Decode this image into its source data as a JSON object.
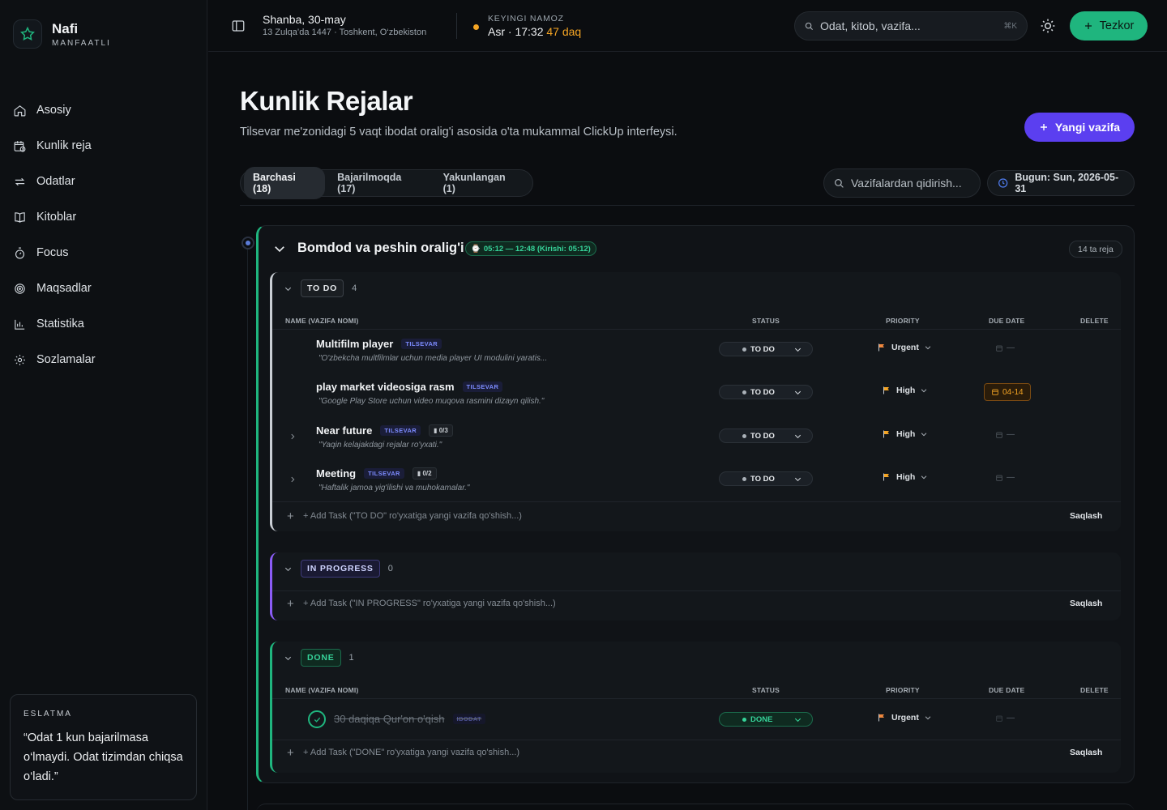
{
  "brand": {
    "name": "Nafi",
    "subtitle": "MANFAATLI"
  },
  "nav": [
    {
      "label": "Asosiy",
      "icon": "home-icon"
    },
    {
      "label": "Kunlik reja",
      "icon": "calendar-clock-icon"
    },
    {
      "label": "Odatlar",
      "icon": "repeat-icon"
    },
    {
      "label": "Kitoblar",
      "icon": "book-icon"
    },
    {
      "label": "Focus",
      "icon": "timer-icon"
    },
    {
      "label": "Maqsadlar",
      "icon": "target-icon"
    },
    {
      "label": "Statistika",
      "icon": "bar-chart-icon"
    },
    {
      "label": "Sozlamalar",
      "icon": "gear-icon"
    }
  ],
  "reminder": {
    "title": "ESLATMA",
    "text": "“Odat 1 kun bajarilmasa o‘lmaydi. Odat tizimdan chiqsa o‘ladi.”"
  },
  "topbar": {
    "date": "Shanba, 30-may",
    "hijri": "13 Zulqa’da 1447 · Toshkent, O‘zbekiston",
    "next_prayer_label": "KEYINGI NAMOZ",
    "next_prayer": "Asr · 17:32",
    "next_prayer_remaining": "47 daq",
    "search_placeholder": "Odat, kitob, vazifa...",
    "search_shortcut": "⌘K",
    "quick_label": "Tezkor"
  },
  "colors": {
    "accent_green": "#1fb57e",
    "accent_purple": "#5b3ff0",
    "warning": "#f5a524"
  },
  "page": {
    "title": "Kunlik Rejalar",
    "subtitle": "Tilsevar me'zonidagi 5 vaqt ibodat oralig'i asosida o'ta mukammal ClickUp interfeysi.",
    "new_task_label": "Yangi vazifa",
    "tabs": [
      "Barchasi (18)",
      "Bajarilmoqda (17)",
      "Yakunlangan (1)"
    ],
    "task_search_placeholder": "Vazifalardan qidirish...",
    "today_label": "Bugun: Sun, 2026-05-31"
  },
  "period": {
    "title": "Bomdod va peshin oralig'i",
    "time": "05:12 — 12:48 (Kirishi: 05:12)",
    "count": "14 ta reja"
  },
  "columns": {
    "name": "NAME (VAZIFA NOMI)",
    "status": "STATUS",
    "priority": "PRIORITY",
    "due": "DUE DATE",
    "delete": "DELETE"
  },
  "groups": {
    "todo": {
      "label": "TO DO",
      "count": "4",
      "tasks": [
        {
          "name": "Multifilm player",
          "tag": "TILSEVAR",
          "sub": "",
          "desc": "\"O'zbekcha multfilmlar uchun media player UI modulini yaratis...",
          "status": "TO DO",
          "priority": "Urgent",
          "due": "—"
        },
        {
          "name": "play market videosiga rasm",
          "tag": "TILSEVAR",
          "sub": "",
          "desc": "\"Google Play Store uchun video muqova rasmini dizayn qilish.\"",
          "status": "TO DO",
          "priority": "High",
          "due": "04-14"
        },
        {
          "name": "Near future",
          "tag": "TILSEVAR",
          "sub": "0/3",
          "desc": "\"Yaqin kelajakdagi rejalar ro'yxati.\"",
          "status": "TO DO",
          "priority": "High",
          "due": "—"
        },
        {
          "name": "Meeting",
          "tag": "TILSEVAR",
          "sub": "0/2",
          "desc": "\"Haftalik jamoa yig'ilishi va muhokamalar.\"",
          "status": "TO DO",
          "priority": "High",
          "due": "—"
        }
      ],
      "add": "+ Add Task (\"TO DO\" ro'yxatiga yangi vazifa qo'shish...)"
    },
    "progress": {
      "label": "IN PROGRESS",
      "count": "0",
      "add": "+ Add Task (\"IN PROGRESS\" ro'yxatiga yangi vazifa qo'shish...)"
    },
    "done": {
      "label": "DONE",
      "count": "1",
      "tasks": [
        {
          "name": "30 daqiqa Qur'on o'qish",
          "tag": "IBODAT",
          "status": "DONE",
          "priority": "Urgent",
          "due": "—"
        }
      ],
      "add": "+ Add Task (\"DONE\" ro'yxatiga yangi vazifa qo'shish...)"
    }
  },
  "save_label": "Saqlash"
}
